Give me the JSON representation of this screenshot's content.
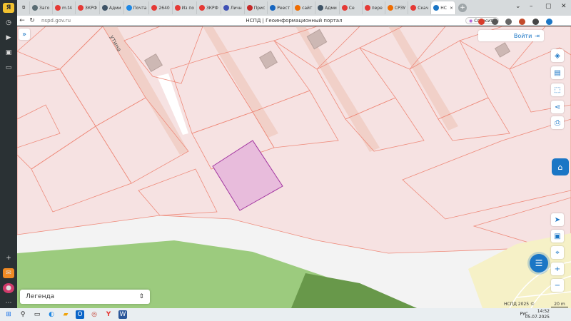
{
  "browser": {
    "tabs": [
      {
        "label": "Заго",
        "color": "#5a6d74"
      },
      {
        "label": "m.t4",
        "color": "#e53935"
      },
      {
        "label": "ЗКРФ",
        "color": "#e53935"
      },
      {
        "label": "Адми",
        "color": "#3e5366"
      },
      {
        "label": "Почта",
        "color": "#1e88e5"
      },
      {
        "label": "2640",
        "color": "#e53935"
      },
      {
        "label": "Из по",
        "color": "#e53935"
      },
      {
        "label": "ЗКРФ",
        "color": "#e53935"
      },
      {
        "label": "Личн",
        "color": "#3f51b5"
      },
      {
        "label": "Прис",
        "color": "#c62828"
      },
      {
        "label": "Реест",
        "color": "#1565c0"
      },
      {
        "label": "сайт",
        "color": "#ef6c00"
      },
      {
        "label": "Адми",
        "color": "#3e5366"
      },
      {
        "label": "Се",
        "color": "#e53935"
      },
      {
        "label": "пере",
        "color": "#e53935"
      },
      {
        "label": "СРЗУ",
        "color": "#ef6c00"
      },
      {
        "label": "Скач",
        "color": "#e53935"
      },
      {
        "label": "НС",
        "color": "#1b76c5",
        "active": true
      }
    ],
    "url": "nspd.gov.ru",
    "page_title": "НСПД | Геоинформационный портал",
    "ask_label": "Спросить"
  },
  "map": {
    "login_label": "Войти",
    "legend_label": "Легенда",
    "street_label": "утина",
    "copyright": "НСПД 2025 ©",
    "scale_label": "20 m",
    "colors": {
      "parcel_fill": "#f6e2e2",
      "parcel_stroke": "#ee8a7a",
      "selected_fill": "#e8bcdc",
      "selected_stroke": "#a235a0",
      "forest": "#9ccb7e",
      "forest_dark": "#68984a",
      "sand": "#f6f1c7",
      "accent": "#1b76c5"
    }
  },
  "taskbar": {
    "lang": "РУС",
    "time": "14:52",
    "date": "05.07.2025"
  }
}
